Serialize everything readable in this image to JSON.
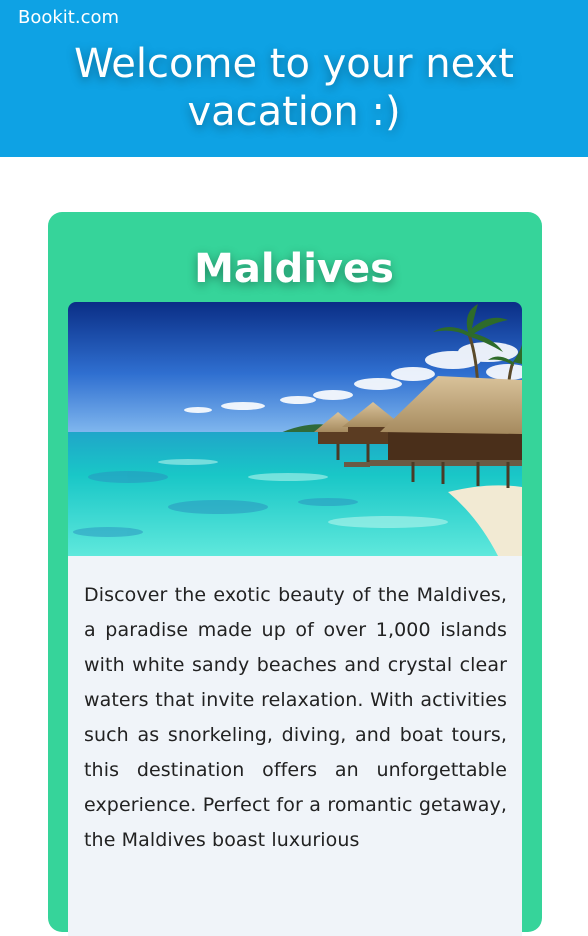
{
  "header": {
    "brand": "Bookit.com",
    "headline": "Welcome to your next vacation :)",
    "background_color": "#0ea2e4"
  },
  "destination": {
    "title": "Maldives",
    "image_icon": "beach-bungalow-photo",
    "description": "Discover the exotic beauty of the Maldives, a paradise made up of over 1,000 islands with white sandy beaches and crystal clear waters that invite relaxation. With activities such as snorkeling, diving, and boat tours, this destination offers an unforgettable experience. Perfect for a romantic getaway, the Maldives boast luxurious",
    "card_color": "#36d49a",
    "description_bg": "#f0f4f9"
  }
}
